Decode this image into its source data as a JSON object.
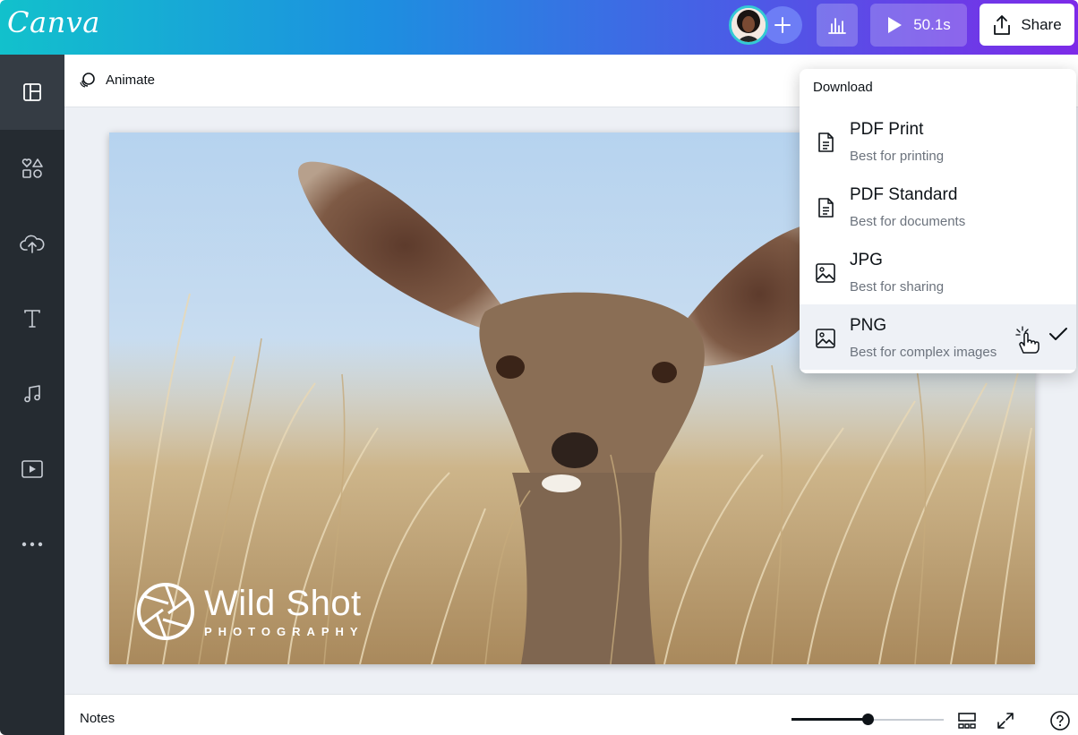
{
  "app": {
    "logo": "Canva"
  },
  "topbar": {
    "play_time": "50.1s",
    "share_label": "Share"
  },
  "toolbar": {
    "animate_label": "Animate"
  },
  "canvas": {
    "brand_name": "Wild Shot",
    "brand_sub": "PHOTOGRAPHY"
  },
  "footer": {
    "notes_label": "Notes",
    "zoom_fraction": 0.5
  },
  "download": {
    "title": "Download",
    "options": [
      {
        "name": "PDF Print",
        "desc": "Best for printing",
        "icon": "document-icon"
      },
      {
        "name": "PDF Standard",
        "desc": "Best for documents",
        "icon": "document-icon"
      },
      {
        "name": "JPG",
        "desc": "Best for sharing",
        "icon": "image-icon"
      },
      {
        "name": "PNG",
        "desc": "Best for complex images",
        "icon": "image-icon"
      }
    ],
    "selected": "PNG"
  },
  "sidebar": {
    "items": [
      "templates-icon",
      "elements-icon",
      "uploads-icon",
      "text-icon",
      "audio-icon",
      "videos-icon",
      "more-icon"
    ]
  }
}
